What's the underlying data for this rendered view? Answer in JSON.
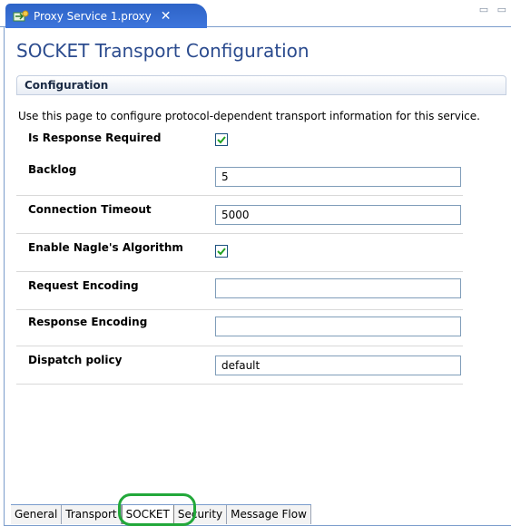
{
  "tab": {
    "title": "Proxy Service 1.proxy",
    "close": "✕"
  },
  "window_controls": "▭ ▭",
  "page_title": "SOCKET Transport Configuration",
  "section": {
    "title": "Configuration"
  },
  "description": "Use this page to configure protocol-dependent transport information for this service.",
  "rows": [
    {
      "label": "Is Response Required",
      "type": "checkbox",
      "checked": true
    },
    {
      "label": "Backlog",
      "type": "text",
      "value": "5"
    },
    {
      "label": "Connection Timeout",
      "type": "text",
      "value": "5000"
    },
    {
      "label": "Enable Nagle's Algorithm",
      "type": "checkbox",
      "checked": true
    },
    {
      "label": "Request Encoding",
      "type": "text",
      "value": ""
    },
    {
      "label": "Response Encoding",
      "type": "text",
      "value": ""
    },
    {
      "label": "Dispatch policy",
      "type": "text",
      "value": "default"
    }
  ],
  "bottom_tabs": [
    {
      "label": "General"
    },
    {
      "label": "Transport"
    },
    {
      "label": "SOCKET",
      "active": true
    },
    {
      "label": "Security"
    },
    {
      "label": "Message Flow"
    }
  ],
  "colors": {
    "accent": "#2d63c7",
    "title": "#2b4b8e",
    "highlight": "#22a83a"
  }
}
